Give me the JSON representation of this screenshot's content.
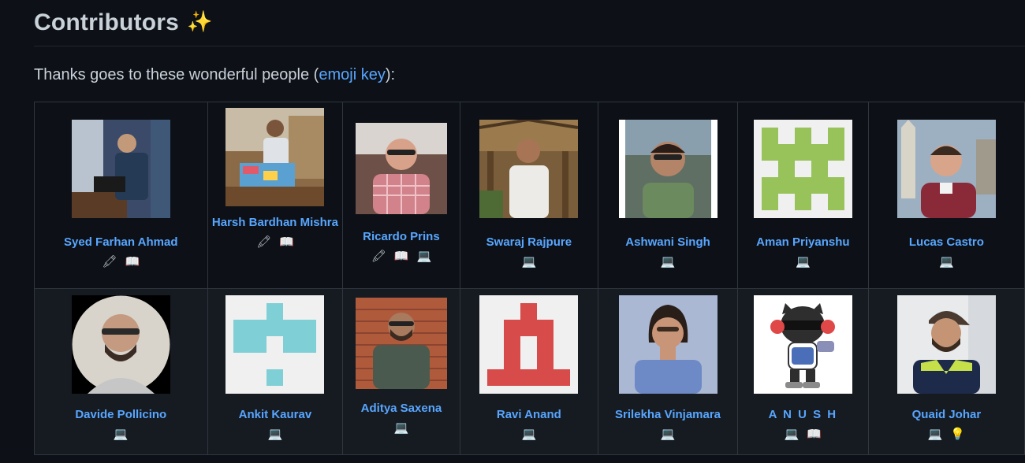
{
  "header": {
    "title": "Contributors",
    "emoji": "✨",
    "intro_prefix": "Thanks goes to these wonderful people (",
    "intro_link": "emoji key",
    "intro_suffix": "):"
  },
  "emoji_key": {
    "design": "🖍",
    "doc": "📖",
    "code": "💻",
    "ideas": "💡"
  },
  "contributors": [
    {
      "name": "Syed Farhan Ahmad",
      "badges": [
        "🖍",
        "📖"
      ],
      "avatar": "photo-speaker-icon"
    },
    {
      "name": "Harsh Bardhan Mishra",
      "badges": [
        "🖍",
        "📖"
      ],
      "avatar": "photo-laptop-icon"
    },
    {
      "name": "Ricardo Prins",
      "badges": [
        "🖍",
        "📖",
        "💻"
      ],
      "avatar": "photo-portrait-icon"
    },
    {
      "name": "Swaraj Rajpure",
      "badges": [
        "💻"
      ],
      "avatar": "photo-hut-icon"
    },
    {
      "name": "Ashwani Singh",
      "badges": [
        "💻"
      ],
      "avatar": "photo-selfie-icon"
    },
    {
      "name": "Aman Priyanshu",
      "badges": [
        "💻"
      ],
      "avatar": "identicon-green-icon"
    },
    {
      "name": "Lucas Castro",
      "badges": [
        "💻"
      ],
      "avatar": "photo-church-icon"
    },
    {
      "name": "Davide Pollicino",
      "badges": [
        "💻"
      ],
      "avatar": "photo-circle-icon"
    },
    {
      "name": "Ankit Kaurav",
      "badges": [
        "💻"
      ],
      "avatar": "identicon-teal-icon"
    },
    {
      "name": "Aditya Saxena",
      "badges": [
        "💻"
      ],
      "avatar": "photo-brickwall-icon"
    },
    {
      "name": "Ravi Anand",
      "badges": [
        "💻"
      ],
      "avatar": "identicon-red-icon"
    },
    {
      "name": "Srilekha Vinjamara",
      "badges": [
        "💻"
      ],
      "avatar": "photo-id-icon"
    },
    {
      "name": "A N U S H",
      "badges": [
        "💻",
        "📖"
      ],
      "avatar": "octocat-cartoon-icon"
    },
    {
      "name": "Quaid Johar",
      "badges": [
        "💻",
        "💡"
      ],
      "avatar": "photo-cap-icon"
    }
  ]
}
